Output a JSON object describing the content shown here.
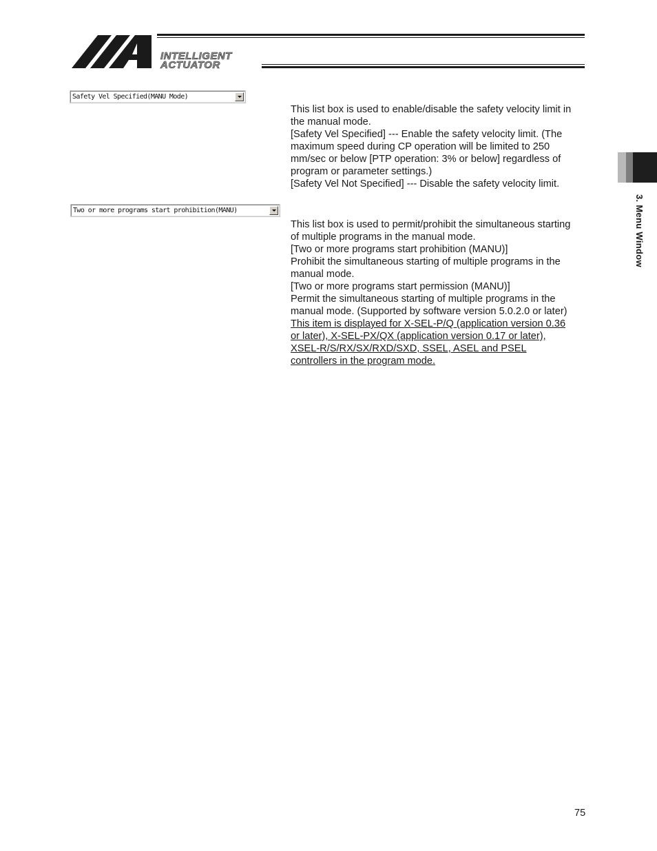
{
  "header": {
    "brand_line1": "INTELLIGENT",
    "brand_line2": "ACTUATOR"
  },
  "items": [
    {
      "combo_value": "Safety Vel Specified(MANU Mode)",
      "lines": [
        "This list box is used to enable/disable the safety velocity limit in",
        "the manual mode.",
        "[Safety Vel Specified] --- Enable the safety velocity limit. (The",
        "maximum speed during CP operation will be limited to 250",
        "mm/sec or below [PTP operation: 3% or below] regardless of",
        "program or parameter settings.)",
        "[Safety Vel Not Specified] --- Disable the safety velocity limit."
      ]
    },
    {
      "combo_value": "Two or more programs start prohibition(MANU)",
      "lines": [
        "This list box is used to permit/prohibit the simultaneous starting",
        "of multiple programs in the manual mode.",
        "[Two or more programs start prohibition (MANU)]",
        "Prohibit the simultaneous starting of multiple programs in the",
        "manual mode.",
        "[Two or more programs start permission (MANU)]",
        "Permit the simultaneous starting of multiple programs in the",
        "manual mode. (Supported by software version 5.0.2.0 or later)"
      ],
      "note_lines": [
        "This item is displayed for X-SEL-P/Q (application version 0.36",
        "or later), X-SEL-PX/QX (application version 0.17 or later),",
        "XSEL-R/S/RX/SX/RXD/SXD, SSEL, ASEL and PSEL",
        "controllers in the program mode."
      ]
    }
  ],
  "side_tab": {
    "label": "3. Menu Window"
  },
  "footer": {
    "page_number": "75"
  },
  "colors": {
    "text": "#1a1a1a",
    "tab_dark": "#1e1e1e",
    "tab_mid": "#7d7d7d",
    "tab_light": "#b9b9b9"
  },
  "icons": [
    "dropdown-arrow-icon"
  ]
}
